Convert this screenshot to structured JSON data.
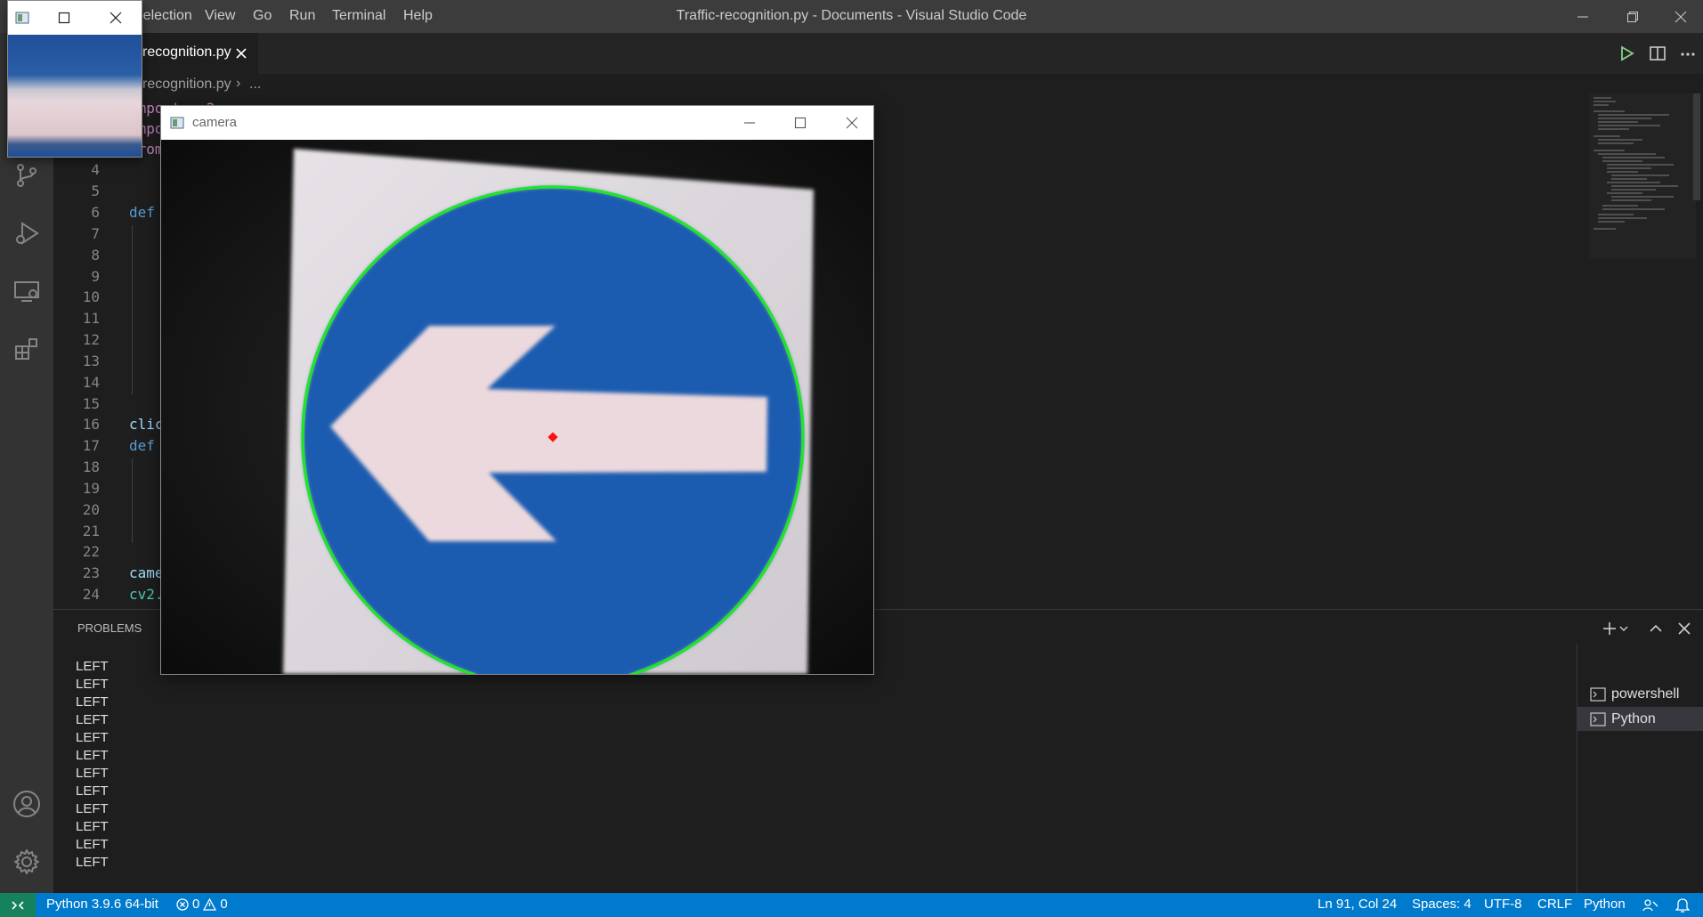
{
  "window": {
    "title": "Traffic-recognition.py - Documents - Visual Studio Code",
    "menu": [
      "Selection",
      "View",
      "Go",
      "Run",
      "Terminal",
      "Help"
    ]
  },
  "editor": {
    "tab_label": "recognition.py",
    "breadcrumb_file": "recognition.py",
    "breadcrumb_rest": "...",
    "line_numbers": [
      "4",
      "5",
      "6",
      "7",
      "8",
      "9",
      "10",
      "11",
      "12",
      "13",
      "14",
      "15",
      "16",
      "17",
      "18",
      "19",
      "20",
      "21",
      "22",
      "23",
      "24"
    ],
    "code": {
      "l1": "import cv2",
      "l2": "impo",
      "l3": "from",
      "l6": "def",
      "l16": "clic",
      "l17": "def",
      "l23": "came",
      "l24": "cv2."
    }
  },
  "panel": {
    "tab_label": "PROBLEMS",
    "output_lines": [
      "LEFT",
      "LEFT",
      "LEFT",
      "LEFT",
      "LEFT",
      "LEFT",
      "LEFT",
      "LEFT",
      "LEFT",
      "LEFT",
      "LEFT",
      "LEFT"
    ],
    "terminals": [
      "powershell",
      "Python"
    ]
  },
  "statusbar": {
    "interpreter": "Python 3.9.6 64-bit",
    "errors": "0",
    "warnings": "0",
    "position": "Ln 91, Col 24",
    "spaces": "Spaces: 4",
    "encoding": "UTF-8",
    "eol": "CRLF",
    "language": "Python"
  },
  "camera_window": {
    "title": "camera"
  },
  "colors": {
    "accent": "#007acc",
    "sign_blue": "#1f5bb0",
    "circle_green": "#22e32a",
    "center_red": "#ff1010"
  }
}
